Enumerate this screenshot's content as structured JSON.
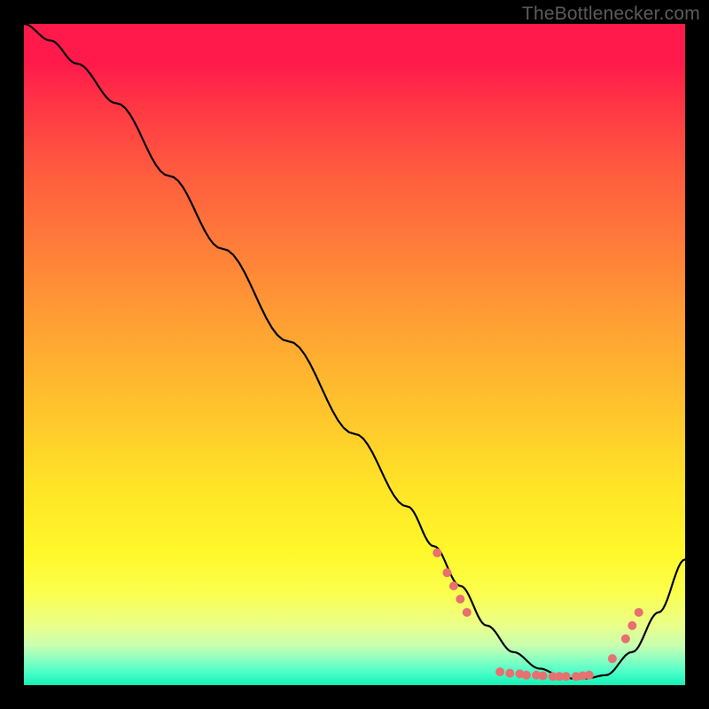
{
  "attribution": "TheBottlenecker.com",
  "chart_data": {
    "type": "line",
    "title": "",
    "xlabel": "",
    "ylabel": "",
    "xlim": [
      0,
      100
    ],
    "ylim": [
      0,
      100
    ],
    "series": [
      {
        "name": "bottleneck-curve",
        "x": [
          0,
          4,
          8,
          14,
          22,
          30,
          40,
          50,
          58,
          62,
          66,
          70,
          74,
          78,
          81,
          83,
          85,
          88,
          92,
          96,
          100
        ],
        "y": [
          100,
          97.5,
          94,
          88,
          77,
          66,
          52,
          38,
          27,
          21,
          15,
          9,
          5,
          2.5,
          1.5,
          1,
          1,
          1.5,
          5,
          11,
          19
        ],
        "color": "#000000"
      }
    ],
    "markers": {
      "name": "highlight-dots",
      "color": "#e87070",
      "radius_px": 5,
      "points": [
        {
          "x": 62.5,
          "y": 20
        },
        {
          "x": 64,
          "y": 17
        },
        {
          "x": 65,
          "y": 15
        },
        {
          "x": 66,
          "y": 13
        },
        {
          "x": 67,
          "y": 11
        },
        {
          "x": 72,
          "y": 2
        },
        {
          "x": 73.5,
          "y": 1.8
        },
        {
          "x": 75,
          "y": 1.7
        },
        {
          "x": 76,
          "y": 1.5
        },
        {
          "x": 77.5,
          "y": 1.5
        },
        {
          "x": 78.5,
          "y": 1.4
        },
        {
          "x": 80,
          "y": 1.3
        },
        {
          "x": 81,
          "y": 1.3
        },
        {
          "x": 82,
          "y": 1.3
        },
        {
          "x": 83.5,
          "y": 1.3
        },
        {
          "x": 84.5,
          "y": 1.4
        },
        {
          "x": 85.5,
          "y": 1.5
        },
        {
          "x": 89,
          "y": 4
        },
        {
          "x": 91,
          "y": 7
        },
        {
          "x": 92,
          "y": 9
        },
        {
          "x": 93,
          "y": 11
        }
      ]
    }
  }
}
